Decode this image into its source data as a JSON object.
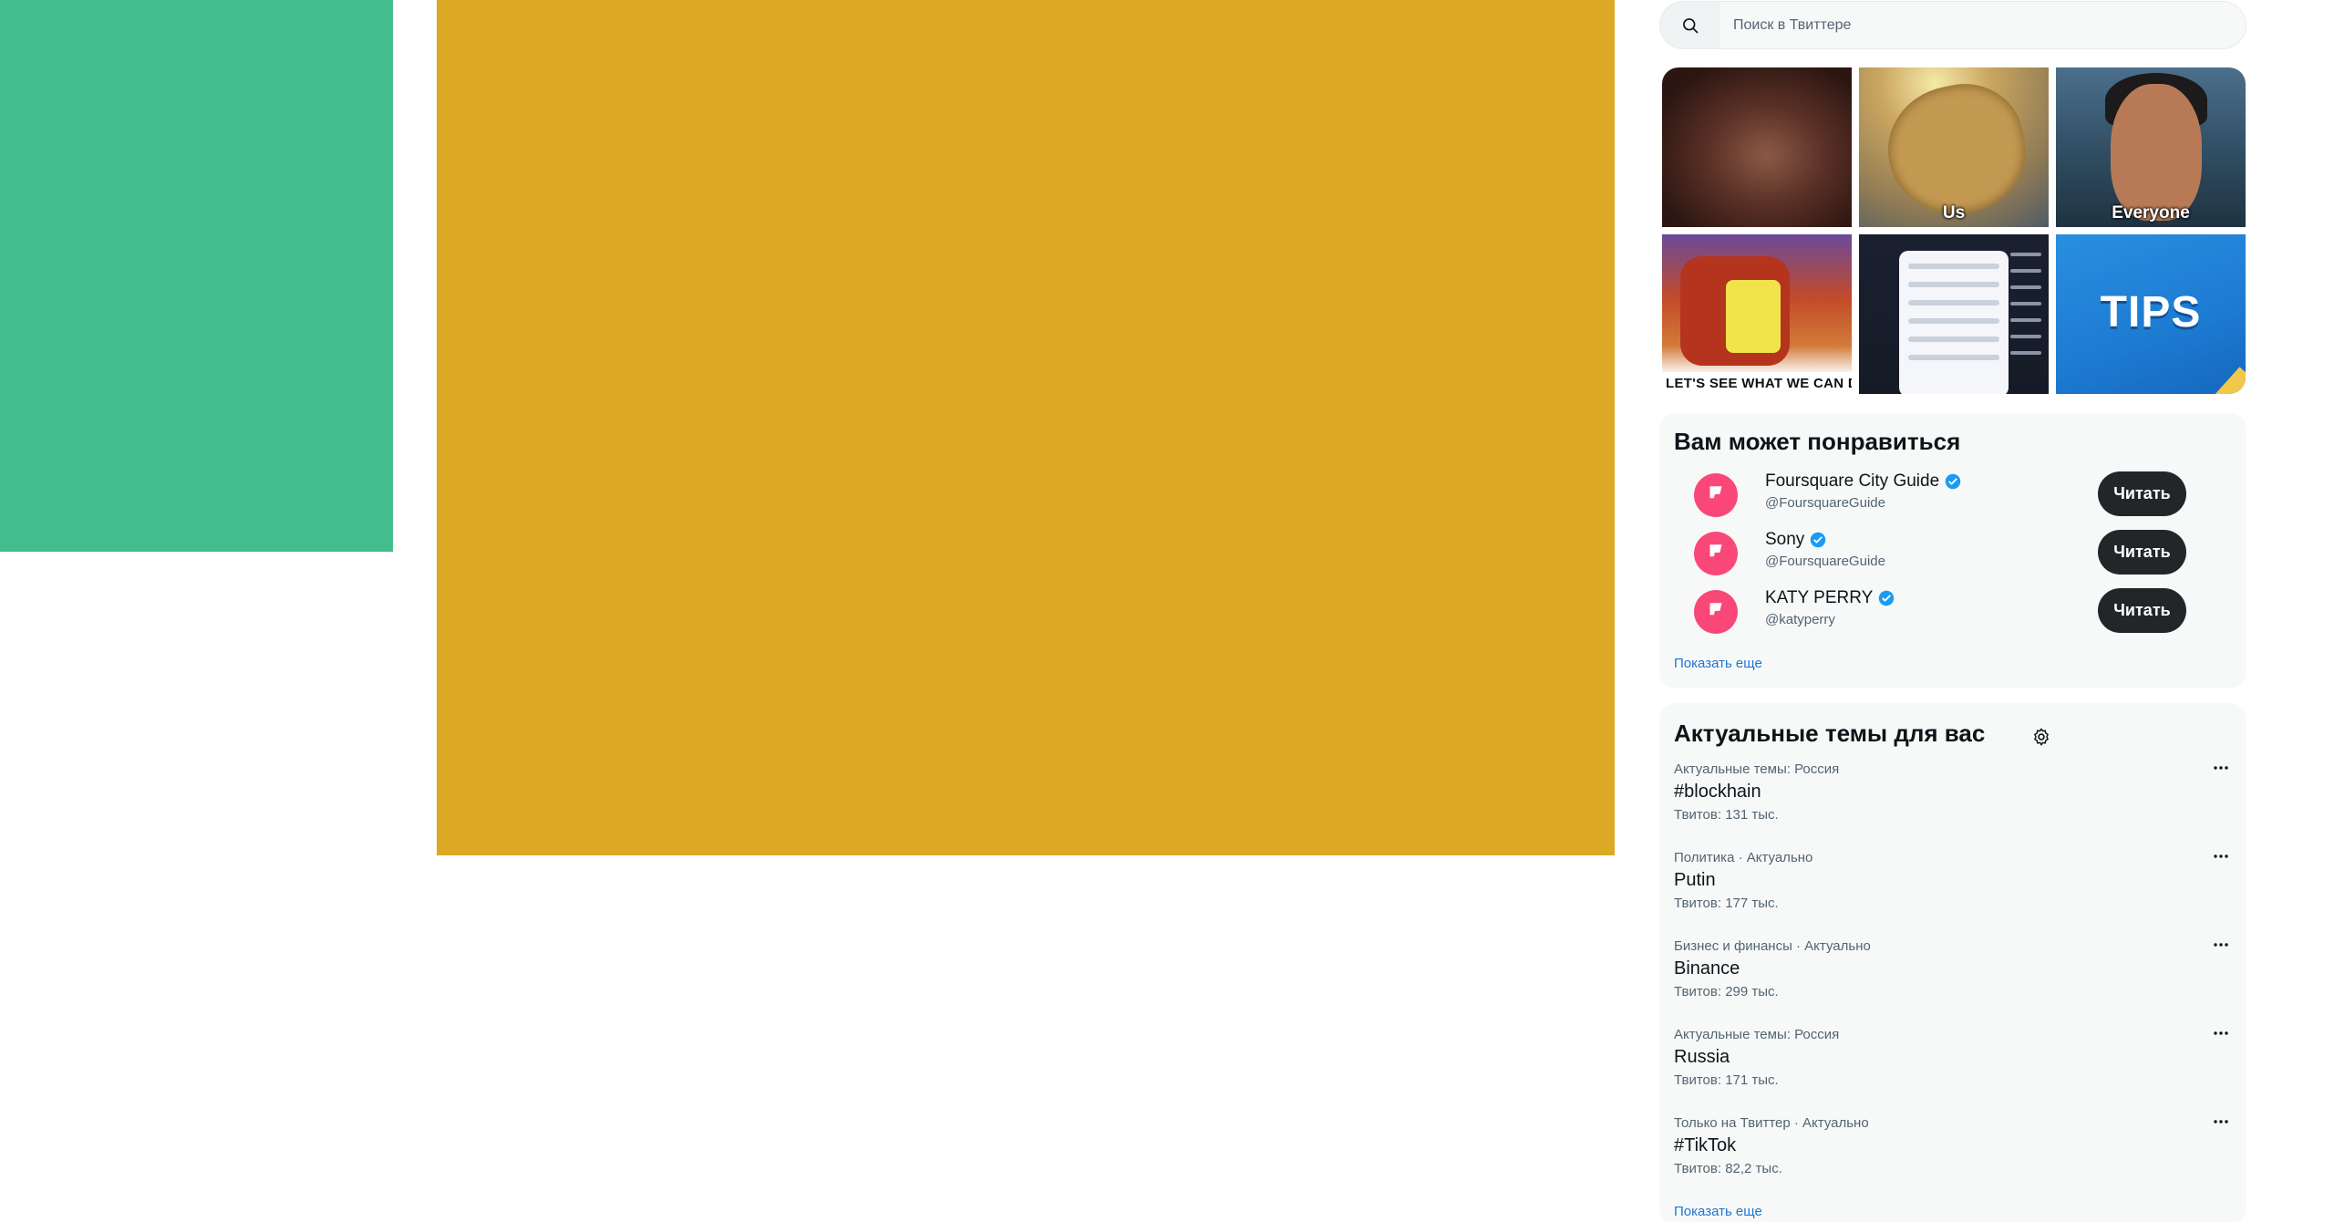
{
  "colors": {
    "left_block": "#42bd8b",
    "center_block": "#dba923",
    "follow_button": "#232629",
    "avatar": "#f94877",
    "verified": "#1d9bf0",
    "link": "#1d76d2"
  },
  "search": {
    "placeholder": "Поиск в Твиттере",
    "icon": "search-icon"
  },
  "media": [
    {
      "caption": ""
    },
    {
      "caption": "Us"
    },
    {
      "caption": "Everyone"
    },
    {
      "caption": "LET'S SEE WHAT WE CAN DO"
    },
    {
      "caption": ""
    },
    {
      "caption": "TIPS"
    }
  ],
  "who_to_follow": {
    "title": "Вам может понравиться",
    "users": [
      {
        "name": "Foursquare City Guide",
        "handle": "@FoursquareGuide",
        "verified": true,
        "button": "Читать"
      },
      {
        "name": "Sony",
        "handle": "@FoursquareGuide",
        "verified": true,
        "button": "Читать"
      },
      {
        "name": "KATY PERRY",
        "handle": "@katyperry",
        "verified": true,
        "button": "Читать"
      }
    ],
    "show_more": "Показать еще"
  },
  "trends": {
    "title": "Актуальные темы для вас",
    "settings_icon": "gear-icon",
    "items": [
      {
        "meta": "Актуальные темы: Россия",
        "name": "#blockhain",
        "count": "Твитов: 131 тыс."
      },
      {
        "meta": "Политика · Актуально",
        "name": "Putin",
        "count": "Твитов: 177 тыс."
      },
      {
        "meta": "Бизнес и финансы · Актуально",
        "name": "Binance",
        "count": "Твитов: 299 тыс."
      },
      {
        "meta": "Актуальные темы: Россия",
        "name": "Russia",
        "count": "Твитов: 171 тыс."
      },
      {
        "meta": "Только на Твиттер · Актуально",
        "name": "#TikTok",
        "count": "Твитов: 82,2 тыс."
      }
    ],
    "show_more": "Показать еще"
  }
}
